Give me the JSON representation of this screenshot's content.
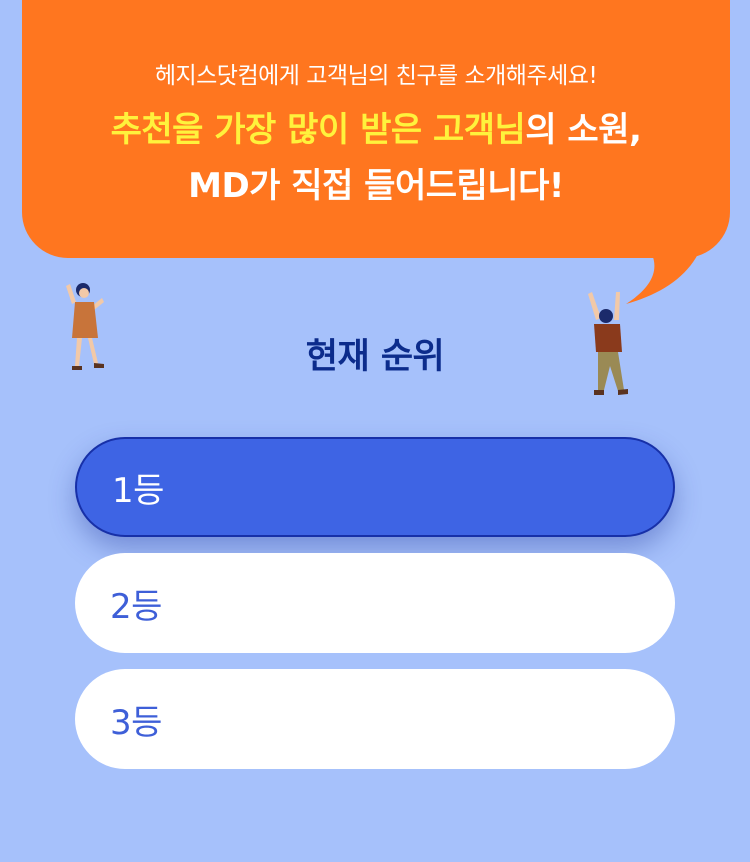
{
  "bubble": {
    "subtitle": "헤지스닷컴에게 고객님의 친구를 소개해주세요!",
    "headline_highlight": "추천을 가장 많이 받은 고객님",
    "headline_rest": "의 소원,",
    "headline_line2": "MD가 직접 들어드립니다!"
  },
  "ranking": {
    "title": "현재 순위",
    "items": [
      {
        "label": "1등"
      },
      {
        "label": "2등"
      },
      {
        "label": "3등"
      }
    ]
  },
  "colors": {
    "background": "#a6c1fb",
    "bubble": "#ff761f",
    "highlight": "#fff23c",
    "title": "#0c2c8c",
    "active_item": "#3e64e4",
    "item_text": "#3e5fd8"
  }
}
